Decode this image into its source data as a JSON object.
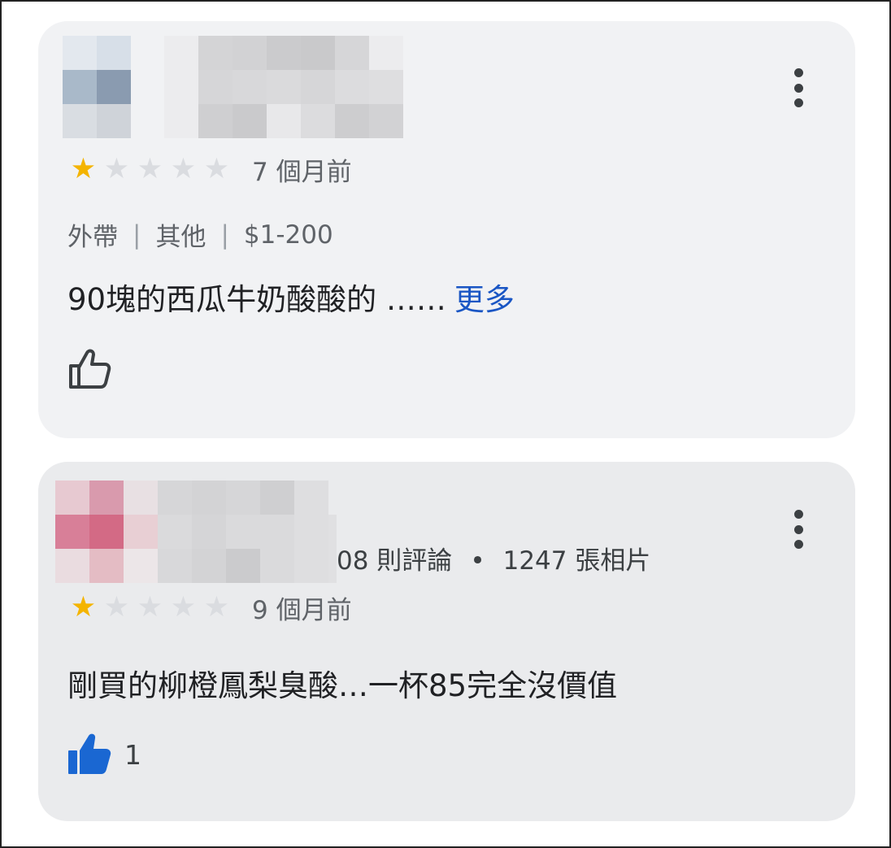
{
  "reviews": [
    {
      "rating": 1,
      "max_rating": 5,
      "time": "7 個月前",
      "tags": [
        "外帶",
        "其他",
        "$1-200"
      ],
      "text": "90塊的西瓜牛奶酸酸的 ……",
      "more_label": "更多",
      "liked": false,
      "like_count": "",
      "avatar_colors": [
        "#e3e8ee",
        "#d7dfe8",
        "#a9b9c9",
        "#8a9bb0",
        "#d9dde2",
        "#cfd3d9"
      ],
      "name_colors": [
        "#ececee",
        "#d4d4d6",
        "#d2d2d4",
        "#cbcbcd",
        "#c9c9cb",
        "#d6d6d8",
        "#ececee",
        "#ececee",
        "#d6d6d8",
        "#d8d8da",
        "#dadadc",
        "#d6d6d8",
        "#dcdcde",
        "#dedee0",
        "#ececee",
        "#cfcfd1",
        "#cacacc",
        "#e8e8ea",
        "#dcdcde",
        "#cdcdcf",
        "#d2d2d4"
      ]
    },
    {
      "rating": 1,
      "max_rating": 5,
      "time": "9 個月前",
      "meta_reviews": "08 則評論",
      "meta_photos": "1247 張相片",
      "meta_dot": "•",
      "text": "剛買的柳橙鳳梨臭酸…一杯85完全沒價值",
      "liked": true,
      "like_count": "1",
      "avatar_colors": [
        "#e7c9d1",
        "#d99aad",
        "#e8e0e3",
        "#d87f98",
        "#d36a85",
        "#e8cfd4",
        "#eadce0",
        "#e4bcc4",
        "#ece6e8"
      ],
      "name_colors": [
        "#d6d6d8",
        "#d3d3d5",
        "#d6d6d8",
        "#cfcfd1",
        "#dedee0",
        "#eaebed",
        "#dadadc",
        "#d5d5d7",
        "#dadadc",
        "#dadadc",
        "#dedee0",
        "#e0e0e2",
        "#d8d8da",
        "#d3d3d5",
        "#cbcbcd",
        "#dadadc",
        "#dedee0",
        "#e0e0e2"
      ]
    }
  ],
  "colors": {
    "star_on": "#f4b400",
    "star_off": "#dadce0",
    "link": "#1a56c4",
    "like_active": "#1a67d2"
  },
  "icons": {
    "menu": "more-vert-icon",
    "like": "thumb-up-icon",
    "star": "star-icon"
  }
}
